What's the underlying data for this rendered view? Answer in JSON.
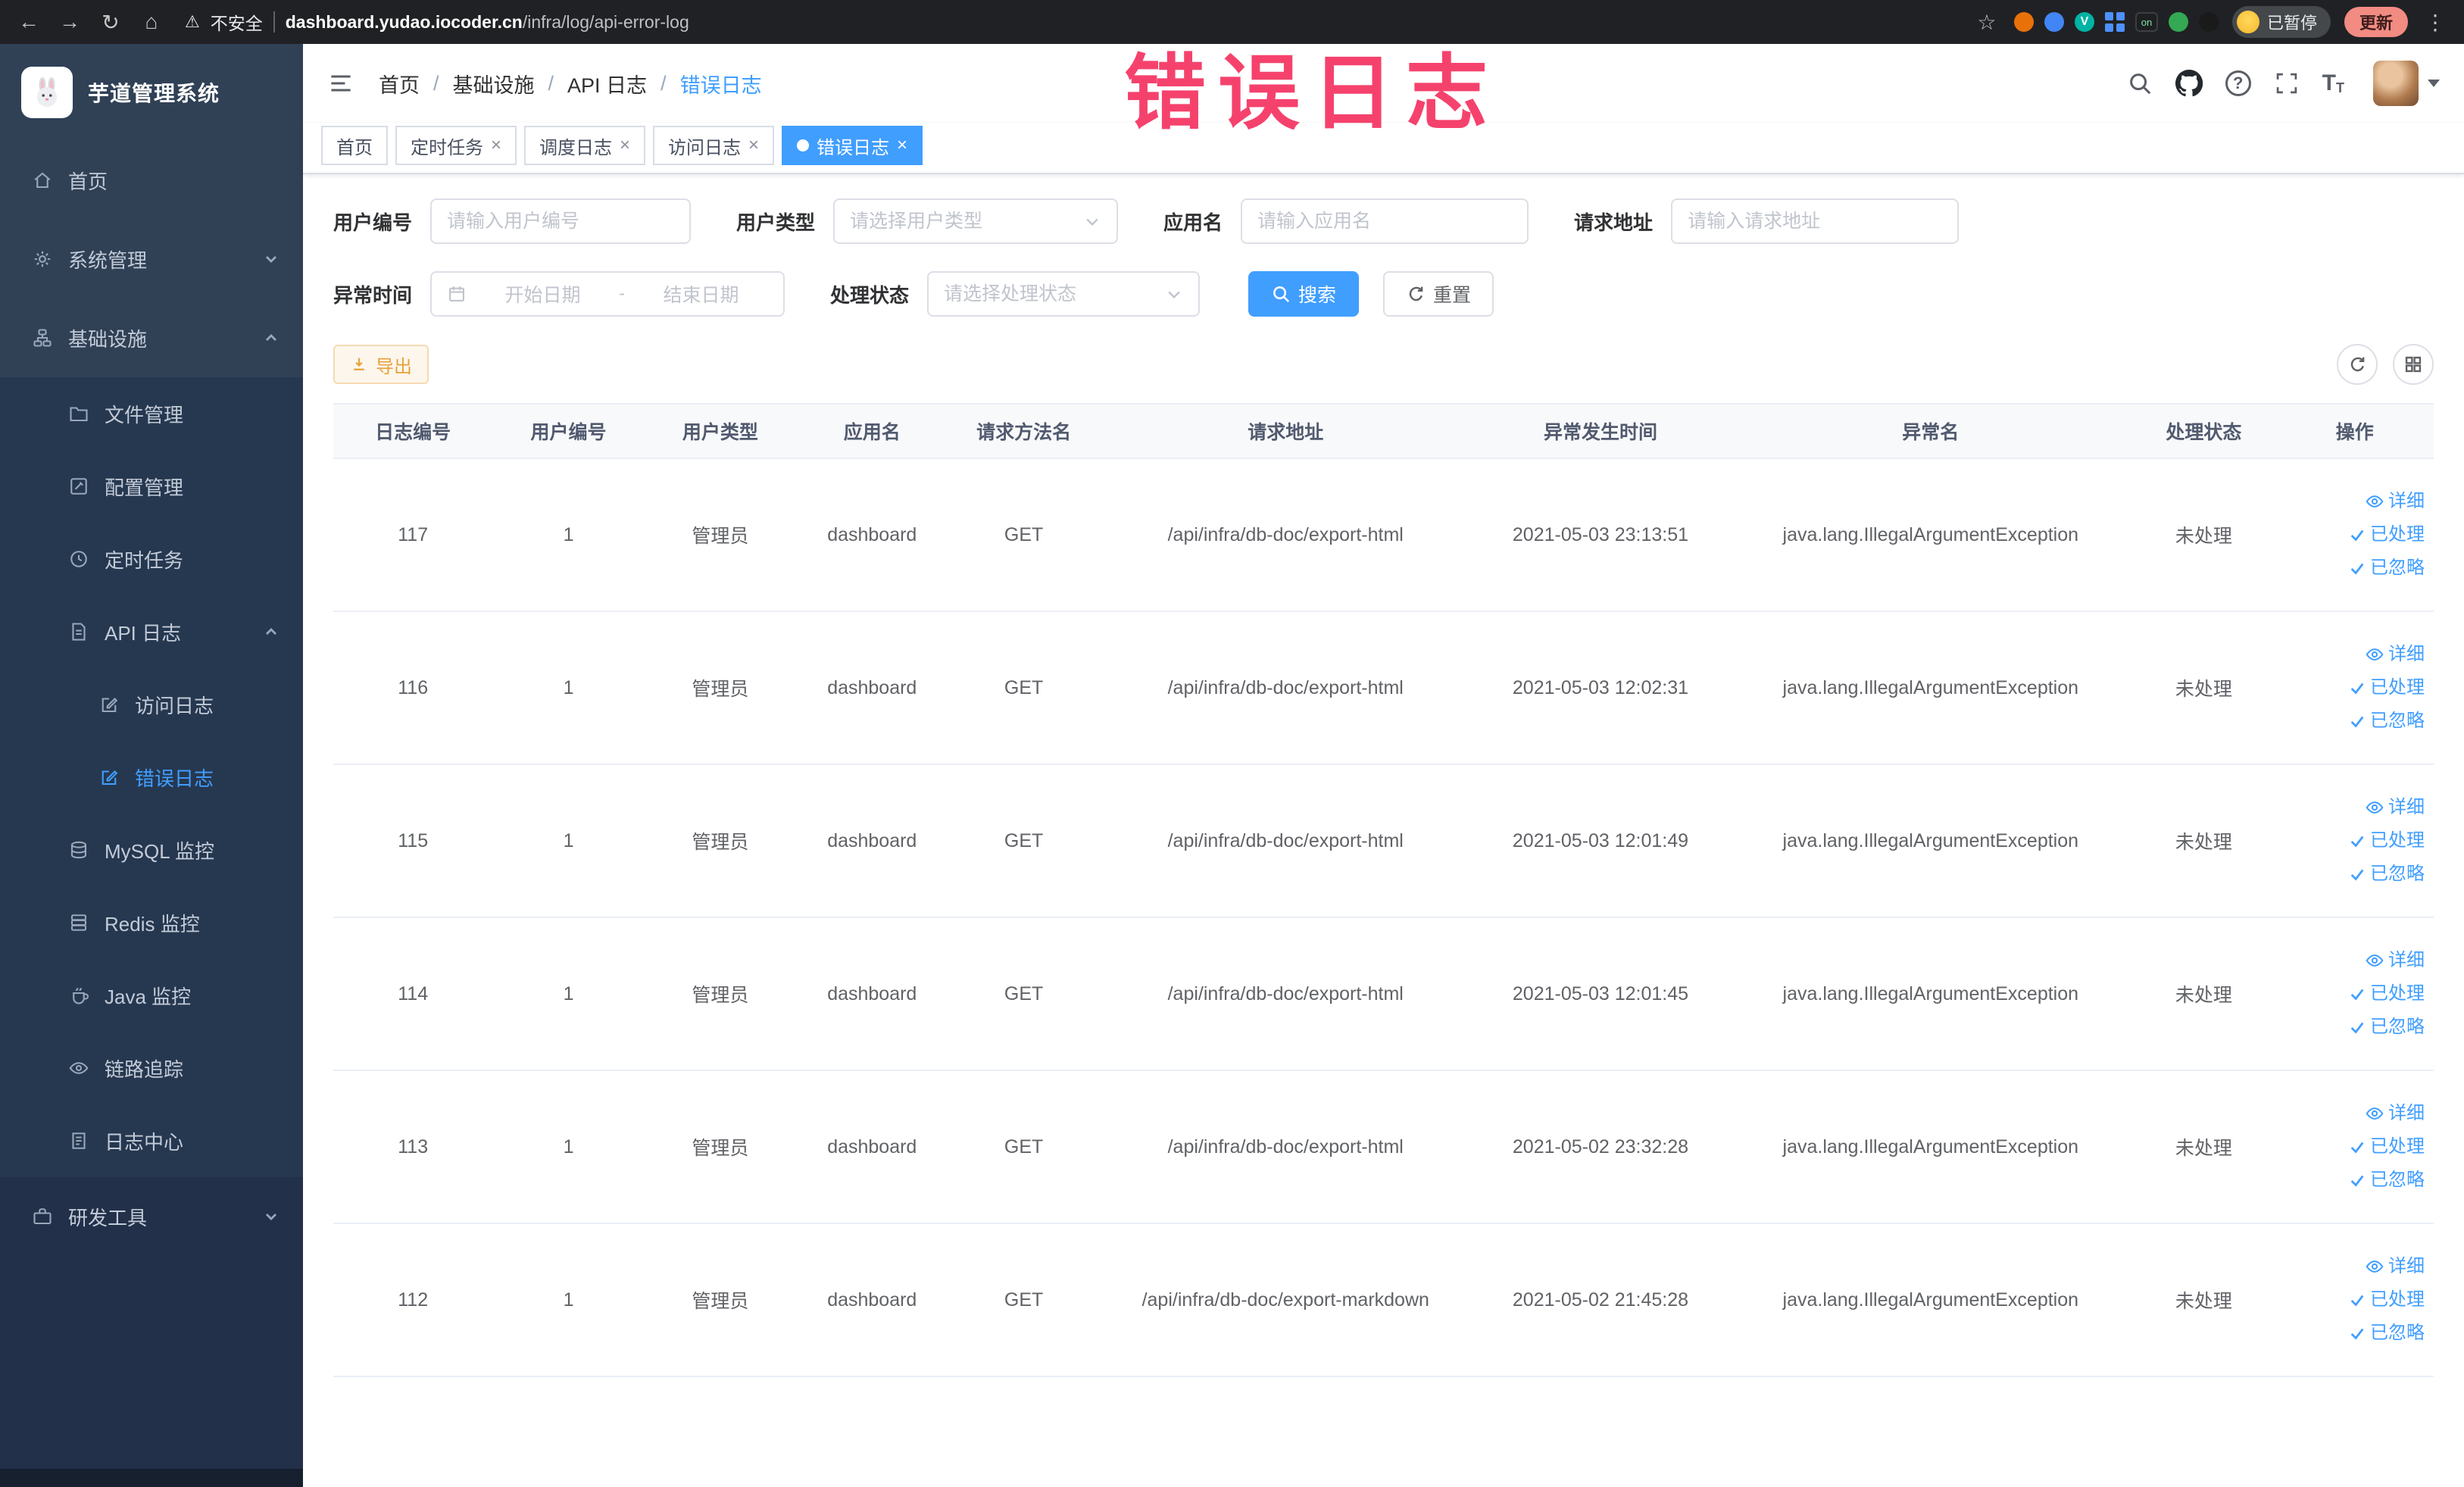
{
  "icons": {
    "back": "←",
    "forward": "→",
    "reload": "↻",
    "home": "⌂",
    "warning": "⚠",
    "star": "☆",
    "kebab": "⋮",
    "close": "×",
    "help": "?",
    "font_big": "T",
    "font_small": "T"
  },
  "browser": {
    "security_label": "不安全",
    "url_domain": "dashboard.yudao.iocoder.cn",
    "url_path": "/infra/log/api-error-log",
    "extension_on_label": "on",
    "profile_label": "已暂停",
    "update_label": "更新"
  },
  "annotation": {
    "text": "错误日志"
  },
  "sidebar": {
    "logo_title": "芋道管理系统",
    "items": [
      {
        "label": "首页"
      },
      {
        "label": "系统管理"
      },
      {
        "label": "基础设施"
      },
      {
        "label": "文件管理"
      },
      {
        "label": "配置管理"
      },
      {
        "label": "定时任务"
      },
      {
        "label": "API 日志"
      },
      {
        "label": "访问日志"
      },
      {
        "label": "错误日志"
      },
      {
        "label": "MySQL 监控"
      },
      {
        "label": "Redis 监控"
      },
      {
        "label": "Java 监控"
      },
      {
        "label": "链路追踪"
      },
      {
        "label": "日志中心"
      },
      {
        "label": "研发工具"
      }
    ]
  },
  "header": {
    "separator": "/",
    "breadcrumb": [
      {
        "label": "首页"
      },
      {
        "label": "基础设施"
      },
      {
        "label": "API 日志"
      },
      {
        "label": "错误日志"
      }
    ]
  },
  "tabs": [
    {
      "label": "首页"
    },
    {
      "label": "定时任务"
    },
    {
      "label": "调度日志"
    },
    {
      "label": "访问日志"
    },
    {
      "label": "错误日志"
    }
  ],
  "filters": {
    "user_id_label": "用户编号",
    "user_id_placeholder": "请输入用户编号",
    "user_type_label": "用户类型",
    "user_type_placeholder": "请选择用户类型",
    "app_name_label": "应用名",
    "app_name_placeholder": "请输入应用名",
    "request_url_label": "请求地址",
    "request_url_placeholder": "请输入请求地址",
    "exception_time_label": "异常时间",
    "start_date_placeholder": "开始日期",
    "range_separator": "-",
    "end_date_placeholder": "结束日期",
    "process_status_label": "处理状态",
    "process_status_placeholder": "请选择处理状态",
    "search_label": "搜索",
    "reset_label": "重置"
  },
  "toolbar": {
    "export_label": "导出"
  },
  "table": {
    "columns": [
      "日志编号",
      "用户编号",
      "用户类型",
      "应用名",
      "请求方法名",
      "请求地址",
      "异常发生时间",
      "异常名",
      "处理状态",
      "操作"
    ],
    "action_labels": [
      "详细",
      "已处理",
      "已忽略"
    ],
    "rows": [
      {
        "id": 117,
        "user_id": 1,
        "user_type": "管理员",
        "app_name": "dashboard",
        "method": "GET",
        "url": "/api/infra/db-doc/export-html",
        "time": "2021-05-03 23:13:51",
        "exception": "java.lang.IllegalArgumentException",
        "status": "未处理"
      },
      {
        "id": 116,
        "user_id": 1,
        "user_type": "管理员",
        "app_name": "dashboard",
        "method": "GET",
        "url": "/api/infra/db-doc/export-html",
        "time": "2021-05-03 12:02:31",
        "exception": "java.lang.IllegalArgumentException",
        "status": "未处理"
      },
      {
        "id": 115,
        "user_id": 1,
        "user_type": "管理员",
        "app_name": "dashboard",
        "method": "GET",
        "url": "/api/infra/db-doc/export-html",
        "time": "2021-05-03 12:01:49",
        "exception": "java.lang.IllegalArgumentException",
        "status": "未处理"
      },
      {
        "id": 114,
        "user_id": 1,
        "user_type": "管理员",
        "app_name": "dashboard",
        "method": "GET",
        "url": "/api/infra/db-doc/export-html",
        "time": "2021-05-03 12:01:45",
        "exception": "java.lang.IllegalArgumentException",
        "status": "未处理"
      },
      {
        "id": 113,
        "user_id": 1,
        "user_type": "管理员",
        "app_name": "dashboard",
        "method": "GET",
        "url": "/api/infra/db-doc/export-html",
        "time": "2021-05-02 23:32:28",
        "exception": "java.lang.IllegalArgumentException",
        "status": "未处理"
      },
      {
        "id": 112,
        "user_id": 1,
        "user_type": "管理员",
        "app_name": "dashboard",
        "method": "GET",
        "url": "/api/infra/db-doc/export-markdown",
        "time": "2021-05-02 21:45:28",
        "exception": "java.lang.IllegalArgumentException",
        "status": "未处理"
      }
    ]
  }
}
